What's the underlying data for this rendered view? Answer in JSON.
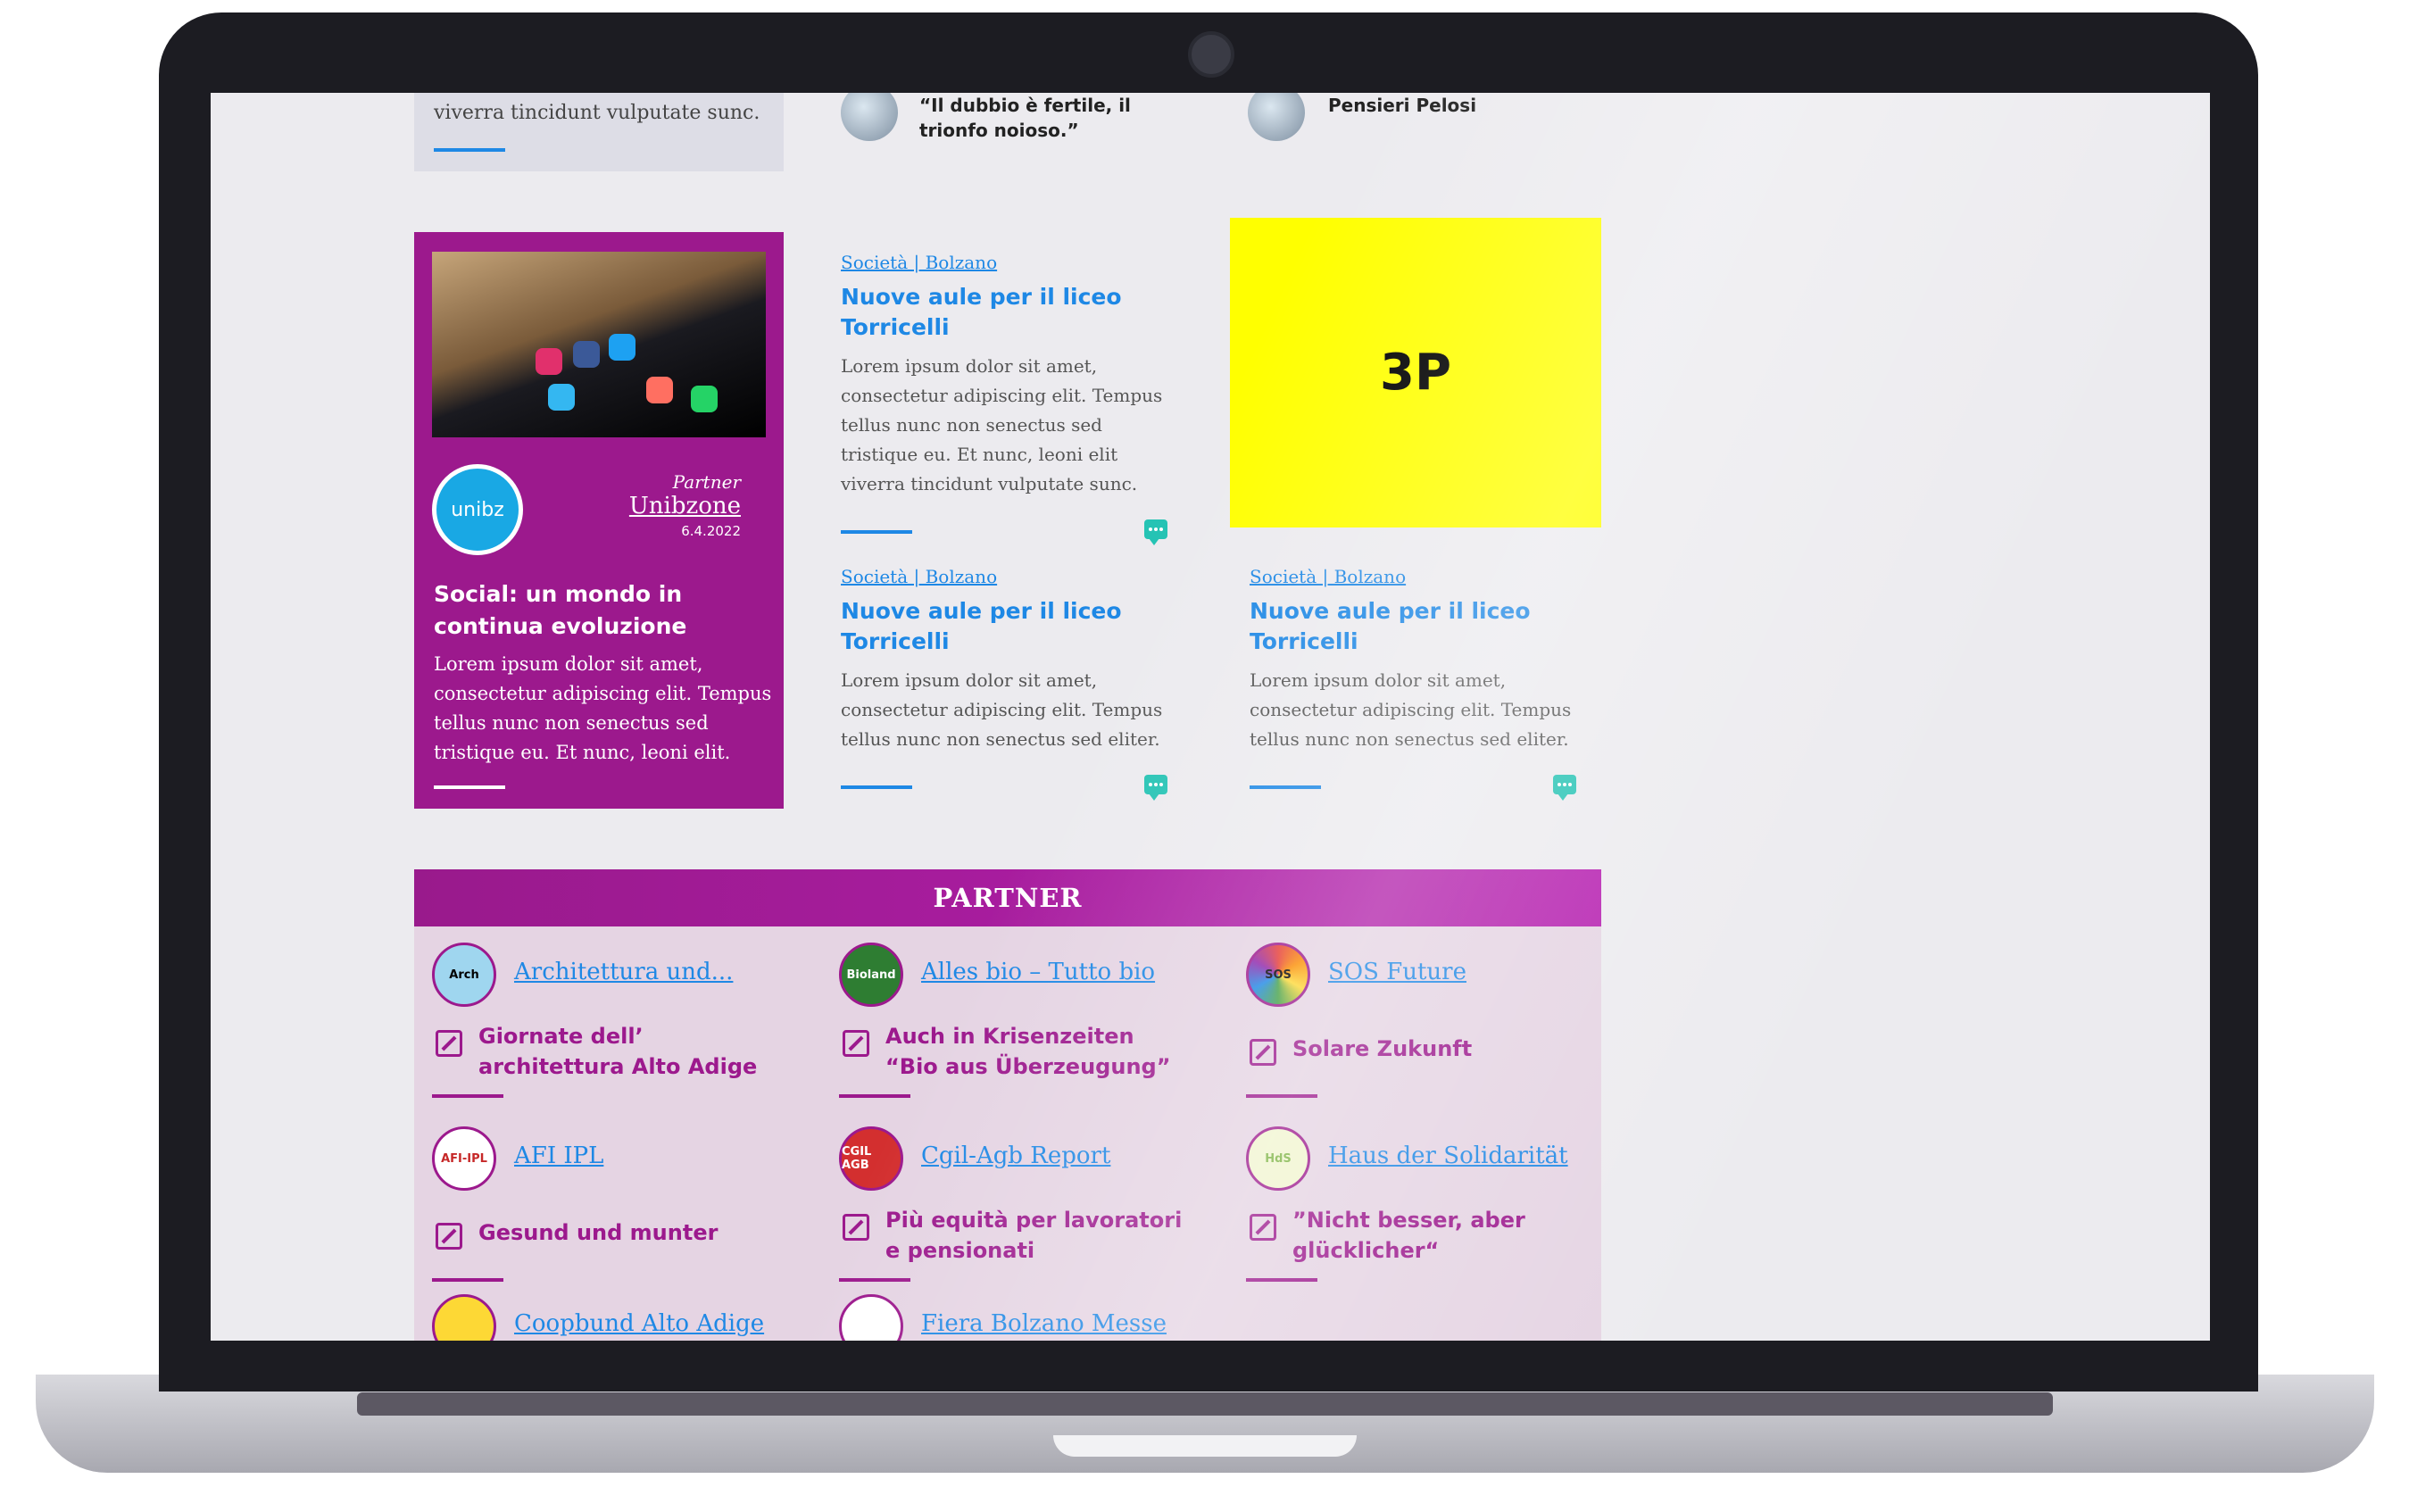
{
  "top_strip": {
    "card_text": "viverra tincidunt vulputate sunc.",
    "quote_1": "“Il dubbio è fertile, il trionfo noioso.”",
    "quote_2": "Pensieri Pelosi"
  },
  "feature_card": {
    "partner_label": "Partner",
    "partner_name": "Unibzone",
    "date": "6.4.2022",
    "logo_text": "unibz",
    "title": "Social: un mondo in continua evoluzione",
    "body": "Lorem ipsum dolor sit amet, consectetur adipiscing elit. Tempus tellus nunc non senectus sed tristique eu. Et nunc, leoni elit."
  },
  "articles": [
    {
      "category": "Società | Bolzano",
      "headline": "Nuove aule per il liceo Torricelli",
      "summary": "Lorem ipsum dolor sit amet, consectetur adipiscing elit. Tempus tellus nunc non senectus sed tristique eu. Et nunc, leoni elit viverra tincidunt vulputate sunc."
    },
    {
      "category": "Società | Bolzano",
      "headline": "Nuove aule per il liceo Torricelli",
      "summary": "Lorem ipsum dolor sit amet, consectetur adipiscing elit. Tempus tellus nunc non senectus sed eliter."
    },
    {
      "category": "Società | Bolzano",
      "headline": "Nuove aule per il liceo Torricelli",
      "summary": "Lorem ipsum dolor sit amet, consectetur adipiscing elit. Tempus tellus nunc non senectus sed eliter."
    }
  ],
  "ad": {
    "label": "3P"
  },
  "partner_section": {
    "header": "PARTNER",
    "partners": [
      {
        "name": "Architettura und...",
        "post": "Giornate dell’ architettura Alto Adige",
        "logo": "Arch"
      },
      {
        "name": "Alles bio – Tutto bio",
        "post": "Auch in Krisenzeiten “Bio aus Überzeugung”",
        "logo": "Bioland"
      },
      {
        "name": "SOS Future",
        "post": "Solare Zukunft",
        "logo": "SOS"
      },
      {
        "name": "AFI IPL",
        "post": "Gesund und munter",
        "logo": "AFI-IPL"
      },
      {
        "name": "Cgil-Agb Report",
        "post": "Più equità per lavoratori e pensionati",
        "logo": "CGIL AGB"
      },
      {
        "name": "Haus der Solidarität",
        "post": "”Nicht besser, aber glücklicher“",
        "logo": "HdS"
      },
      {
        "name": "Coopbund Alto Adige",
        "post": "",
        "logo": ""
      },
      {
        "name": "Fiera Bolzano Messe",
        "post": "",
        "logo": ""
      }
    ]
  },
  "colors": {
    "accent_purple": "#9c198d",
    "link_blue": "#1e88e5",
    "ad_yellow": "#ffff00",
    "comment_teal": "#25c3b4"
  },
  "icons": [
    "comment-icon",
    "edit-icon",
    "camera-icon"
  ]
}
